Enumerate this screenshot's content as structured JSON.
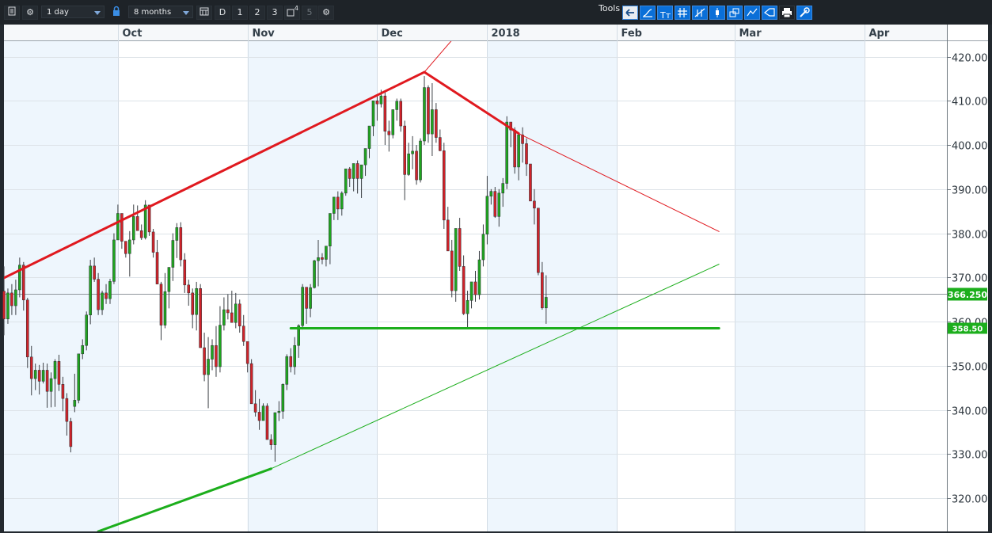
{
  "toolbar": {
    "interval": "1 day",
    "range": "8 months",
    "period_buttons": [
      "D",
      "1",
      "2",
      "3",
      "4",
      "5"
    ],
    "tools_label": "Tools",
    "tool_icons": [
      "arrow-left-icon",
      "curve-icon",
      "text-icon",
      "grid-icon",
      "crosshair-icon",
      "candle-icon",
      "layers-icon",
      "indicator-icon",
      "comment-icon",
      "print-icon",
      "settings-icon"
    ]
  },
  "colors": {
    "up": "#1fa51f",
    "down": "#d0232a",
    "resistance": "#e0191f",
    "support": "#1cae1c",
    "price_badge": "#1cae1c",
    "plot_bg": "#ffffff",
    "band_bg": "#eef6fd"
  },
  "chart_data": {
    "type": "candlestick",
    "title": "",
    "x_tick_labels": [
      "Oct",
      "Nov",
      "Dec",
      "2018",
      "Feb",
      "Mar",
      "Apr"
    ],
    "y_tick_labels": [
      "420.00",
      "410.00",
      "400.00",
      "390.00",
      "380.00",
      "370.00",
      "360.00",
      "350.00",
      "340.00",
      "330.00",
      "320.00"
    ],
    "y_ticks": [
      420,
      410,
      400,
      390,
      380,
      370,
      360,
      350,
      340,
      330,
      320
    ],
    "x_tick_positions": [
      47,
      80,
      113,
      141,
      174,
      204,
      237
    ],
    "x_range": [
      18,
      258
    ],
    "ylim": [
      312.5,
      423.5
    ],
    "last_price": "366.250",
    "last_price_value": 366.25,
    "support_level_label": "358.50",
    "support_level_value": 358.5,
    "candles": [
      [
        18,
        366.9,
        372.5,
        356.9,
        360.6
      ],
      [
        19,
        360.6,
        367.5,
        359.5,
        366.5
      ],
      [
        20,
        366.5,
        368.5,
        361.5,
        363.6
      ],
      [
        21,
        363.6,
        369.5,
        361.5,
        367.2
      ],
      [
        22,
        367.2,
        374.5,
        365.5,
        372.8
      ],
      [
        23,
        372.8,
        373.5,
        362.5,
        364.9
      ],
      [
        24,
        364.9,
        365.4,
        349.5,
        352.0
      ],
      [
        25,
        352.0,
        354.5,
        343.3,
        347.1
      ],
      [
        26,
        347.1,
        350.5,
        344.5,
        349.0
      ],
      [
        27,
        349.0,
        350.2,
        343.5,
        346.5
      ],
      [
        28,
        346.5,
        350.7,
        346.0,
        349.0
      ],
      [
        29,
        349.0,
        350.5,
        340.5,
        344.2
      ],
      [
        30,
        344.2,
        348.5,
        340.6,
        347.1
      ],
      [
        31,
        347.1,
        351.5,
        340.7,
        351.0
      ],
      [
        32,
        351.0,
        352.5,
        344.3,
        345.8
      ],
      [
        33,
        345.8,
        347.5,
        339.7,
        342.6
      ],
      [
        34,
        342.6,
        343.8,
        334.2,
        337.4
      ],
      [
        35,
        337.4,
        338.2,
        330.4,
        331.7
      ],
      [
        36,
        340.8,
        348.2,
        339.5,
        342.2
      ],
      [
        37,
        342.2,
        352.5,
        341.5,
        352.7
      ],
      [
        38,
        352.7,
        356.0,
        351.5,
        354.6
      ],
      [
        39,
        354.6,
        362.3,
        353.5,
        361.5
      ],
      [
        40,
        361.5,
        374.0,
        359.4,
        372.6
      ],
      [
        41,
        372.6,
        374.5,
        369.0,
        369.6
      ],
      [
        42,
        369.6,
        371.0,
        361.5,
        362.7
      ],
      [
        43,
        362.7,
        367.0,
        361.5,
        366.5
      ],
      [
        44,
        366.5,
        368.5,
        364.0,
        365.2
      ],
      [
        45,
        365.2,
        369.7,
        364.0,
        369.1
      ],
      [
        46,
        369.1,
        380.0,
        368.5,
        378.5
      ],
      [
        47,
        378.5,
        386.5,
        380.5,
        384.5
      ],
      [
        48,
        384.5,
        383.5,
        376.5,
        378.2
      ],
      [
        49,
        378.2,
        377.8,
        374.5,
        375.4
      ],
      [
        50,
        375.4,
        380.5,
        370.2,
        378.5
      ],
      [
        51,
        378.5,
        386.5,
        377.5,
        383.8
      ],
      [
        52,
        383.8,
        386.3,
        381.0,
        380.6
      ],
      [
        53,
        380.6,
        382.0,
        378.5,
        379.0
      ],
      [
        54,
        379.0,
        387.5,
        378.6,
        386.4
      ],
      [
        55,
        386.4,
        384.3,
        379.4,
        380.3
      ],
      [
        56,
        380.3,
        381.0,
        374.5,
        375.7
      ],
      [
        57,
        375.7,
        378.5,
        369.5,
        368.5
      ],
      [
        58,
        368.5,
        369.0,
        355.8,
        359.2
      ],
      [
        59,
        359.2,
        371.0,
        358.5,
        366.8
      ],
      [
        60,
        366.8,
        371.0,
        363.0,
        372.3
      ],
      [
        61,
        372.3,
        380.0,
        369.2,
        378.4
      ],
      [
        62,
        378.4,
        382.3,
        374.4,
        381.3
      ],
      [
        63,
        381.3,
        382.5,
        372.5,
        374.0
      ],
      [
        64,
        374.0,
        375.5,
        366.5,
        368.3
      ],
      [
        65,
        368.3,
        369.5,
        363.6,
        366.5
      ],
      [
        66,
        366.5,
        367.5,
        358.5,
        361.6
      ],
      [
        67,
        361.6,
        369.0,
        358.0,
        367.5
      ],
      [
        68,
        367.5,
        368.5,
        354.6,
        354.1
      ],
      [
        69,
        354.1,
        357.5,
        346.5,
        348.0
      ],
      [
        70,
        348.0,
        356.5,
        340.4,
        351.5
      ],
      [
        71,
        351.5,
        356.0,
        349.0,
        354.6
      ],
      [
        72,
        354.6,
        359.0,
        347.5,
        349.8
      ],
      [
        73,
        349.8,
        363.5,
        348.5,
        359.2
      ],
      [
        74,
        359.2,
        365.5,
        358.0,
        362.7
      ],
      [
        75,
        362.7,
        366.2,
        360.5,
        362.0
      ],
      [
        76,
        362.0,
        367.0,
        359.9,
        359.8
      ],
      [
        77,
        359.8,
        366.5,
        358.5,
        364.0
      ],
      [
        78,
        364.0,
        365.0,
        357.5,
        359.0
      ],
      [
        79,
        359.0,
        361.5,
        354.5,
        355.5
      ],
      [
        80,
        355.5,
        351.0,
        348.5,
        350.5
      ],
      [
        81,
        350.5,
        351.5,
        341.5,
        341.4
      ],
      [
        82,
        341.4,
        344.5,
        338.5,
        339.5
      ],
      [
        83,
        339.5,
        342.5,
        335.5,
        337.6
      ],
      [
        84,
        337.6,
        341.5,
        338.6,
        340.9
      ],
      [
        85,
        340.9,
        341.5,
        333.5,
        333.3
      ],
      [
        86,
        333.3,
        334.5,
        331.0,
        332.1
      ],
      [
        87,
        332.1,
        338.0,
        328.3,
        339.4
      ],
      [
        88,
        339.4,
        342.0,
        337.5,
        339.7
      ],
      [
        89,
        339.7,
        346.0,
        338.0,
        345.8
      ],
      [
        90,
        345.8,
        352.6,
        344.5,
        352.1
      ],
      [
        91,
        352.1,
        354.0,
        348.5,
        349.8
      ],
      [
        92,
        349.8,
        356.5,
        348.0,
        354.6
      ],
      [
        93,
        354.6,
        359.4,
        351.8,
        359.1
      ],
      [
        94,
        359.1,
        368.5,
        358.2,
        367.8
      ],
      [
        95,
        367.8,
        366.5,
        359.5,
        363.0
      ],
      [
        96,
        363.0,
        368.5,
        361.0,
        367.7
      ],
      [
        97,
        367.7,
        374.0,
        367.5,
        373.8
      ],
      [
        98,
        373.8,
        378.5,
        368.0,
        374.5
      ],
      [
        99,
        374.5,
        375.5,
        373.0,
        374.1
      ],
      [
        100,
        374.1,
        376.5,
        372.5,
        377.1
      ],
      [
        101,
        377.1,
        378.5,
        373.0,
        384.5
      ],
      [
        102,
        384.5,
        385.5,
        383.0,
        388.2
      ],
      [
        103,
        388.2,
        389.5,
        383.0,
        385.5
      ],
      [
        104,
        385.5,
        389.5,
        384.0,
        389.1
      ],
      [
        105,
        389.1,
        394.5,
        388.5,
        394.6
      ],
      [
        106,
        394.6,
        395.0,
        390.5,
        392.4
      ],
      [
        107,
        392.4,
        395.5,
        389.5,
        395.8
      ],
      [
        108,
        395.8,
        396.5,
        389.0,
        392.4
      ],
      [
        109,
        392.4,
        395.0,
        388.0,
        395.5
      ],
      [
        110,
        395.5,
        397.0,
        393.0,
        399.2
      ],
      [
        111,
        399.2,
        403.5,
        397.0,
        404.3
      ],
      [
        112,
        404.3,
        407.5,
        402.0,
        410.0
      ],
      [
        113,
        410.0,
        411.5,
        405.5,
        409.3
      ],
      [
        114,
        409.3,
        412.5,
        408.5,
        411.1
      ],
      [
        115,
        411.1,
        412.0,
        400.0,
        403.1
      ],
      [
        116,
        403.1,
        405.5,
        398.5,
        402.3
      ],
      [
        117,
        402.3,
        408.0,
        401.5,
        408.0
      ],
      [
        118,
        408.0,
        410.5,
        405.5,
        409.9
      ],
      [
        119,
        409.9,
        410.5,
        403.0,
        404.3
      ],
      [
        120,
        404.3,
        405.5,
        387.5,
        393.3
      ],
      [
        121,
        393.3,
        400.5,
        393.0,
        398.0
      ],
      [
        122,
        398.0,
        402.0,
        394.5,
        398.6
      ],
      [
        123,
        398.6,
        400.0,
        391.0,
        392.1
      ],
      [
        124,
        392.1,
        401.5,
        391.5,
        400.9
      ],
      [
        125,
        400.9,
        415.6,
        400.0,
        413.0
      ],
      [
        126,
        413.0,
        413.5,
        400.5,
        402.5
      ],
      [
        127,
        402.5,
        414.0,
        397.5,
        408.0
      ],
      [
        128,
        408.0,
        409.5,
        400.5,
        401.7
      ],
      [
        129,
        401.7,
        403.5,
        398.6,
        398.7
      ],
      [
        130,
        398.7,
        400.5,
        381.0,
        383.0
      ],
      [
        131,
        383.0,
        386.0,
        376.0,
        376.0
      ],
      [
        132,
        376.0,
        378.5,
        365.5,
        367.0
      ],
      [
        133,
        367.0,
        375.5,
        364.5,
        381.1
      ],
      [
        134,
        381.1,
        383.5,
        371.5,
        372.5
      ],
      [
        135,
        372.5,
        375.0,
        361.5,
        361.8
      ],
      [
        136,
        361.8,
        367.0,
        358.5,
        364.8
      ],
      [
        137,
        364.8,
        368.0,
        363.0,
        369.0
      ],
      [
        138,
        369.0,
        371.5,
        364.5,
        366.1
      ],
      [
        139,
        366.1,
        376.0,
        365.0,
        374.0
      ],
      [
        140,
        374.0,
        382.0,
        372.5,
        379.8
      ],
      [
        141,
        379.8,
        393.0,
        377.5,
        388.4
      ],
      [
        142,
        388.4,
        390.0,
        386.5,
        389.5
      ],
      [
        143,
        389.5,
        390.5,
        383.5,
        383.8
      ],
      [
        144,
        383.8,
        390.0,
        381.5,
        389.1
      ],
      [
        145,
        389.1,
        392.5,
        386.0,
        391.3
      ],
      [
        146,
        391.3,
        406.5,
        390.0,
        405.2
      ],
      [
        147,
        405.2,
        405.0,
        399.5,
        403.4
      ],
      [
        148,
        403.4,
        404.0,
        393.5,
        395.0
      ],
      [
        149,
        395.0,
        402.5,
        392.0,
        402.3
      ],
      [
        150,
        402.3,
        404.0,
        396.0,
        400.3
      ],
      [
        151,
        400.3,
        401.5,
        393.0,
        395.7
      ],
      [
        152,
        395.7,
        393.5,
        389.0,
        387.3
      ],
      [
        153,
        387.3,
        390.0,
        382.0,
        385.7
      ],
      [
        154,
        385.7,
        384.5,
        370.5,
        371.1
      ],
      [
        155,
        371.1,
        373.5,
        362.7,
        363.1
      ],
      [
        156,
        363.1,
        370.5,
        359.5,
        365.5
      ]
    ],
    "lines": [
      {
        "kind": "resistance",
        "points": [
          [
            18,
            369.9
          ],
          [
            125,
            416.5
          ]
        ],
        "weight": "thick"
      },
      {
        "kind": "resistance",
        "points": [
          [
            125,
            416.5
          ],
          [
            141,
            433.0
          ]
        ],
        "weight": "thin"
      },
      {
        "kind": "resistance",
        "points": [
          [
            125,
            416.5
          ],
          [
            149,
            402.6
          ]
        ],
        "weight": "thick"
      },
      {
        "kind": "resistance",
        "points": [
          [
            149,
            402.6
          ],
          [
            200,
            380.4
          ]
        ],
        "weight": "thin"
      },
      {
        "kind": "support",
        "points": [
          [
            42,
            312.5
          ],
          [
            86,
            326.7
          ]
        ],
        "weight": "thick"
      },
      {
        "kind": "support",
        "points": [
          [
            86,
            326.7
          ],
          [
            200,
            373.0
          ]
        ],
        "weight": "thin"
      },
      {
        "kind": "support",
        "points": [
          [
            91,
            358.5
          ],
          [
            200,
            358.5
          ]
        ],
        "weight": "thick"
      }
    ]
  }
}
